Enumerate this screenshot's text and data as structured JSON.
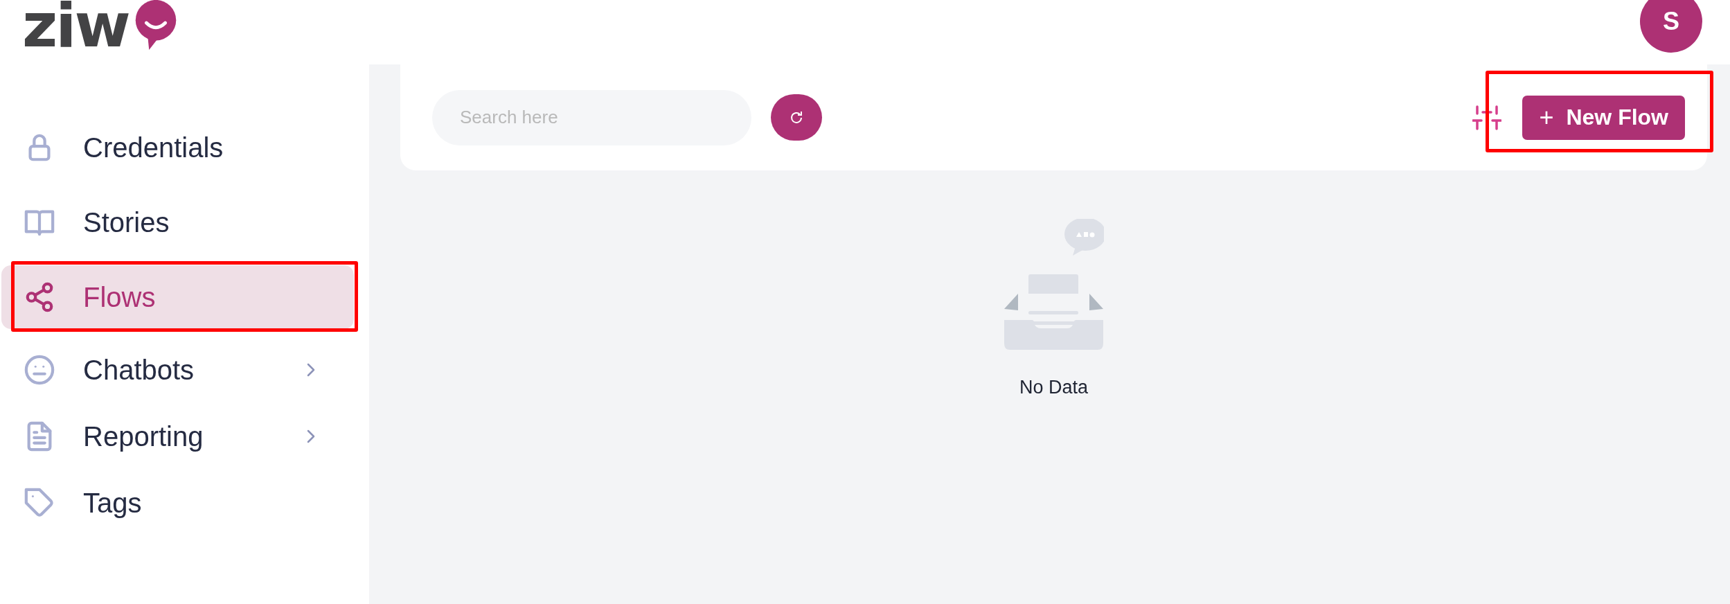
{
  "header": {
    "logo_text": "ziw",
    "avatar_initial": "S"
  },
  "sidebar": {
    "items": [
      {
        "label": "Credentials",
        "selected": false,
        "highlighted": false,
        "has_submenu": false
      },
      {
        "label": "Stories",
        "selected": false,
        "highlighted": false,
        "has_submenu": false
      },
      {
        "label": "Flows",
        "selected": true,
        "highlighted": true,
        "has_submenu": false
      },
      {
        "label": "Chatbots",
        "selected": false,
        "highlighted": false,
        "has_submenu": true
      },
      {
        "label": "Reporting",
        "selected": false,
        "highlighted": false,
        "has_submenu": true
      },
      {
        "label": "Tags",
        "selected": false,
        "highlighted": false,
        "has_submenu": false
      }
    ]
  },
  "toolbar": {
    "search": {
      "placeholder": "Search here"
    },
    "new_button": {
      "label": "New Flow",
      "icon": "+",
      "highlighted": true
    }
  },
  "empty_state": {
    "text": "No Data"
  }
}
